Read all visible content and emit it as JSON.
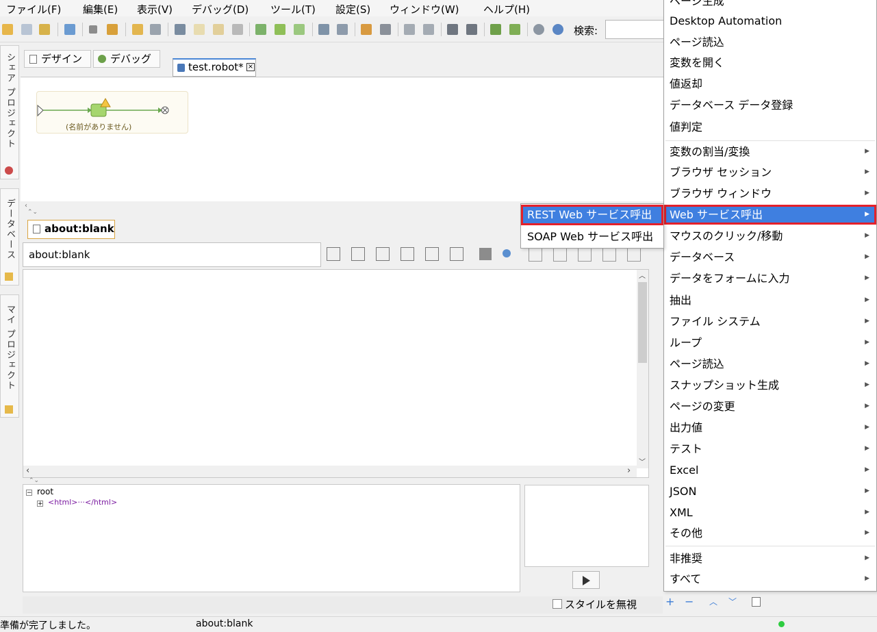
{
  "colors": {
    "menu_highlight": "#3f7fe0",
    "highlight_outline": "#e5202a",
    "status_ok": "#2ecc40"
  },
  "menubar": {
    "items": [
      "ファイル(F)",
      "編集(E)",
      "表示(V)",
      "デバッグ(D)",
      "ツール(T)",
      "設定(S)",
      "ウィンドウ(W)",
      "ヘルプ(H)"
    ]
  },
  "toolbar": {
    "search_label": "検索:",
    "search_value": ""
  },
  "side": {
    "share_project": "シェア プロジェクト",
    "database": "データベース",
    "my_project": "マイ プロジェクト"
  },
  "editor": {
    "design_tab": "デザイン",
    "debug_tab": "デバッグ",
    "file_tab": "test.robot*",
    "flow_step_label": "(名前がありません)"
  },
  "browser": {
    "tab_label": "about:blank",
    "url": "about:blank",
    "tree_root": "root",
    "tree_child": "<html>···</html>",
    "ignore_style_label": "スタイルを無視"
  },
  "status": {
    "message": "準備が完了しました。",
    "url": "about:blank"
  },
  "context_menu": {
    "group1": [
      "ページ生成",
      "Desktop Automation",
      "ページ読込",
      "変数を開く",
      "値返却",
      "データベース データ登録",
      "値判定"
    ],
    "group2": [
      "変数の割当/変換",
      "ブラウザ セッション",
      "ブラウザ ウィンドウ",
      "Web サービス呼出",
      "マウスのクリック/移動",
      "データベース",
      "データをフォームに入力",
      "抽出",
      "ファイル システム",
      "ループ",
      "ページ読込",
      "スナップショット生成",
      "ページの変更",
      "出力値",
      "テスト",
      "Excel",
      "JSON",
      "XML",
      "その他"
    ],
    "group3": [
      "非推奨",
      "すべて"
    ],
    "selected": "Web サービス呼出"
  },
  "sub_menu": {
    "items": [
      "REST Web サービス呼出",
      "SOAP Web サービス呼出"
    ],
    "selected": "REST Web サービス呼出"
  }
}
